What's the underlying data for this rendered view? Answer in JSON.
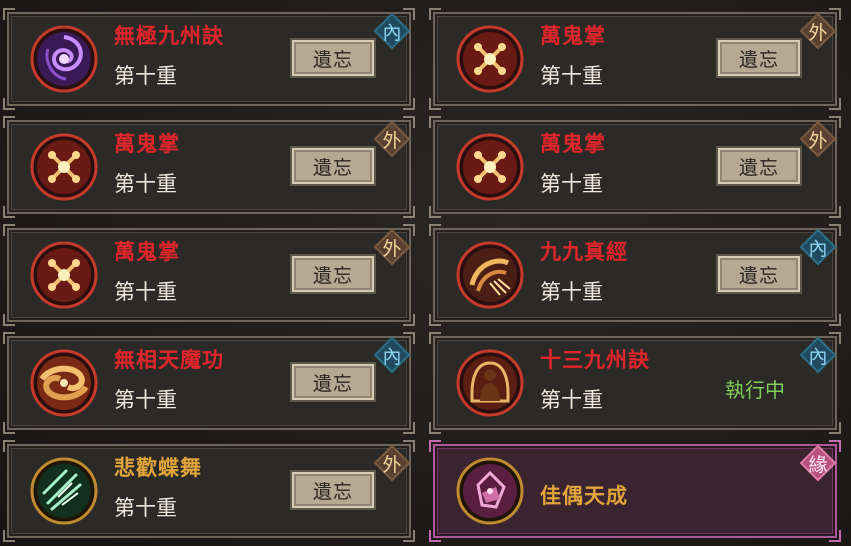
{
  "buttons": {
    "forget": "遺忘"
  },
  "level_text": "第十重",
  "cards": [
    {
      "name": "無極九州訣",
      "name_color": "red",
      "level": "第十重",
      "badge": "內",
      "badge_type": "nei",
      "action": "遺忘",
      "icon": "purple-vortex-icon"
    },
    {
      "name": "萬鬼掌",
      "name_color": "red",
      "level": "第十重",
      "badge": "外",
      "badge_type": "wai",
      "action": "遺忘",
      "icon": "flame-palm-icon"
    },
    {
      "name": "萬鬼掌",
      "name_color": "red",
      "level": "第十重",
      "badge": "外",
      "badge_type": "wai",
      "action": "遺忘",
      "icon": "flame-palm-icon"
    },
    {
      "name": "萬鬼掌",
      "name_color": "red",
      "level": "第十重",
      "badge": "外",
      "badge_type": "wai",
      "action": "遺忘",
      "icon": "flame-palm-icon"
    },
    {
      "name": "萬鬼掌",
      "name_color": "red",
      "level": "第十重",
      "badge": "外",
      "badge_type": "wai",
      "action": "遺忘",
      "icon": "flame-palm-icon"
    },
    {
      "name": "九九真經",
      "name_color": "red",
      "level": "第十重",
      "badge": "內",
      "badge_type": "nei",
      "action": "遺忘",
      "icon": "golden-wave-icon"
    },
    {
      "name": "無相天魔功",
      "name_color": "red",
      "level": "第十重",
      "badge": "內",
      "badge_type": "nei",
      "action": "遺忘",
      "icon": "golden-swirl-icon"
    },
    {
      "name": "十三九州訣",
      "name_color": "red",
      "level": "第十重",
      "badge": "內",
      "badge_type": "nei",
      "status": "執行中",
      "icon": "meditating-figure-icon"
    },
    {
      "name": "悲歡蝶舞",
      "name_color": "gold",
      "level": "第十重",
      "badge": "外",
      "badge_type": "wai",
      "action": "遺忘",
      "icon": "jade-shards-icon"
    },
    {
      "name": "佳偶天成",
      "name_color": "gold",
      "badge": "緣",
      "badge_type": "yuan",
      "icon": "pink-heart-icon"
    }
  ]
}
